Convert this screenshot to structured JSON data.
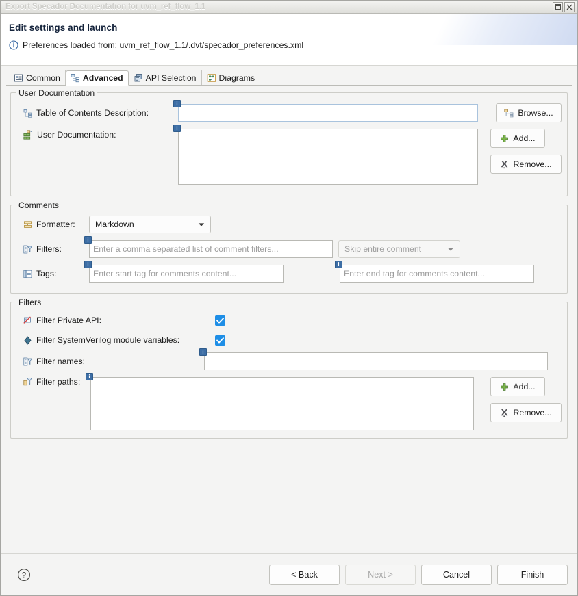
{
  "window": {
    "title": "Export Specador Documentation for uvm_ref_flow_1.1",
    "controls": [
      {
        "name": "restore-button",
        "glyph": "restore"
      },
      {
        "name": "close-button",
        "glyph": "close"
      }
    ]
  },
  "header": {
    "title": "Edit settings and launch",
    "message": "Preferences loaded from: uvm_ref_flow_1.1/.dvt/specador_preferences.xml",
    "info_icon": "info-icon"
  },
  "tabs": [
    {
      "label": "Common",
      "icon": "common-tab-icon",
      "selected": false
    },
    {
      "label": "Advanced",
      "icon": "advanced-tab-icon",
      "selected": true
    },
    {
      "label": "API Selection",
      "icon": "api-selection-tab-icon",
      "selected": false
    },
    {
      "label": "Diagrams",
      "icon": "diagrams-tab-icon",
      "selected": false
    }
  ],
  "user_documentation": {
    "group_title": "User Documentation",
    "toc": {
      "label": "Table of Contents Description:",
      "icon": "toc-icon",
      "value": "",
      "placeholder": "",
      "badge": "i"
    },
    "browse_button": "Browse...",
    "userdoc": {
      "label": "User Documentation:",
      "icon": "userdoc-icon",
      "value": "",
      "badge": "i"
    },
    "add_button": "Add...",
    "remove_button": "Remove..."
  },
  "comments": {
    "group_title": "Comments",
    "formatter": {
      "label": "Formatter:",
      "icon": "formatter-icon",
      "value": "Markdown",
      "options": [
        "Markdown"
      ]
    },
    "filters": {
      "label": "Filters:",
      "icon": "filters-icon",
      "value": "",
      "placeholder": "Enter a comma separated list of comment filters...",
      "badge": "i",
      "mode": {
        "value": "Skip entire comment",
        "disabled": true
      }
    },
    "tags": {
      "label": "Tags:",
      "icon": "tags-icon",
      "start": {
        "value": "",
        "placeholder": "Enter start tag for comments content...",
        "badge": "i"
      },
      "end": {
        "value": "",
        "placeholder": "Enter end tag for comments content...",
        "badge": "i"
      }
    }
  },
  "filters": {
    "group_title": "Filters",
    "private_api": {
      "label": "Filter Private API:",
      "icon": "private-api-icon",
      "checked": true
    },
    "sv_module_vars": {
      "label": "Filter SystemVerilog module variables:",
      "icon": "systemverilog-icon",
      "checked": true
    },
    "filter_names": {
      "label": "Filter names:",
      "icon": "filter-names-icon",
      "value": "",
      "placeholder": "",
      "badge": "i"
    },
    "filter_paths": {
      "label": "Filter paths:",
      "icon": "filter-paths-icon",
      "value": "",
      "badge": "i"
    },
    "add_button": "Add...",
    "remove_button": "Remove..."
  },
  "footer": {
    "help_icon": "help-icon",
    "back_button": "< Back",
    "next_button": "Next >",
    "cancel_button": "Cancel",
    "finish_button": "Finish"
  },
  "colors": {
    "accent_blue": "#1e8ee6",
    "badge_blue": "#3d6ea5",
    "title_text": "#14233b",
    "add_green": "#7bb549"
  }
}
